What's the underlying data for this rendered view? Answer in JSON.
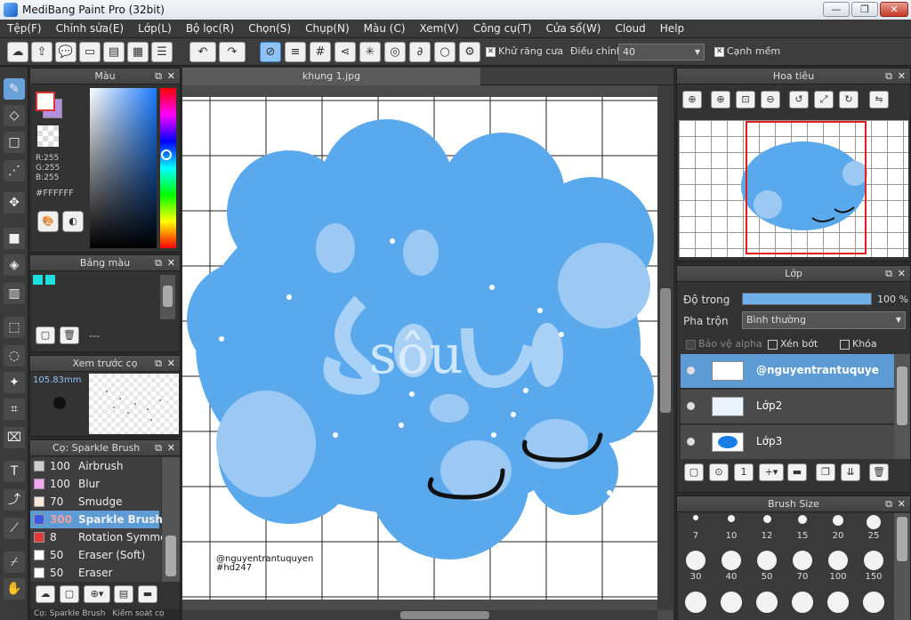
{
  "app": {
    "title": "MediBang Paint Pro (32bit)"
  },
  "window_buttons": {
    "minimize": "—",
    "maximize": "❐",
    "close": "✕"
  },
  "menu": [
    "Tệp(F)",
    "Chỉnh sửa(E)",
    "Lớp(L)",
    "Bộ lọc(R)",
    "Chọn(S)",
    "Chụp(N)",
    "Màu (C)",
    "Xem(V)",
    "Công cụ(T)",
    "Cửa sổ(W)",
    "Cloud",
    "Help"
  ],
  "toolbar": {
    "antialias_label": "Khử răng cưa",
    "adjust_label": "Điều chỉnh",
    "adjust_value": "40",
    "smooth_edge_label": "Cạnh mềm",
    "antialias_checked": true,
    "smooth_checked": true
  },
  "color_panel": {
    "title": "Màu",
    "r": "R:255",
    "g": "G:255",
    "b": "B:255",
    "hex": "#FFFFFF",
    "primary_color": "#ffffff",
    "secondary_color": "#b48fe0"
  },
  "palette_panel": {
    "title": "Bảng màu",
    "swatches": [
      "#1fe0e0",
      "#1fe0e0"
    ],
    "footer_text": "---"
  },
  "preview_panel": {
    "title": "Xem trước cọ",
    "size": "105.83mm"
  },
  "brush_panel": {
    "title": "Cọ: Sparkle Brush",
    "items": [
      {
        "size": "100",
        "name": "Airbrush",
        "color": "#cccccc"
      },
      {
        "size": "100",
        "name": "Blur",
        "color": "#f2a6f2"
      },
      {
        "size": "70",
        "name": "Smudge",
        "color": "#f8e6d6"
      },
      {
        "size": "300",
        "name": "Sparkle Brush",
        "color": "#3b59e6",
        "selected": true
      },
      {
        "size": "8",
        "name": "Rotation Symme",
        "color": "#e23a3a"
      },
      {
        "size": "50",
        "name": "Eraser (Soft)",
        "color": "#ffffff"
      },
      {
        "size": "50",
        "name": "Eraser",
        "color": "#ffffff"
      }
    ],
    "bottom_tabs": [
      "Cọ: Sparkle Brush",
      "Kiểm soát cọ"
    ]
  },
  "document": {
    "tab_title": "khung 1.jpg",
    "canvas_text": "sôu",
    "credit_line1": "@nguyentrantuquyen",
    "credit_line2": "#hd247"
  },
  "navigator": {
    "title": "Hoa tiêu"
  },
  "layer_panel": {
    "title": "Lớp",
    "opacity_label": "Độ trong",
    "opacity_value": "100 %",
    "opacity_percent": 100,
    "blend_label": "Pha trộn",
    "blend_value": "Bình thường",
    "protect_alpha": "Bảo vệ alpha",
    "clipping": "Xén bớt",
    "lock": "Khóa",
    "layers": [
      {
        "name": "@nguyentrantuquye",
        "selected": true
      },
      {
        "name": "Lớp2",
        "selected": false
      },
      {
        "name": "Lớp3",
        "selected": false
      }
    ]
  },
  "brush_size_panel": {
    "title": "Brush Size",
    "sizes": [
      "7",
      "10",
      "12",
      "15",
      "20",
      "25",
      "30",
      "40",
      "50",
      "70",
      "100",
      "150"
    ]
  }
}
